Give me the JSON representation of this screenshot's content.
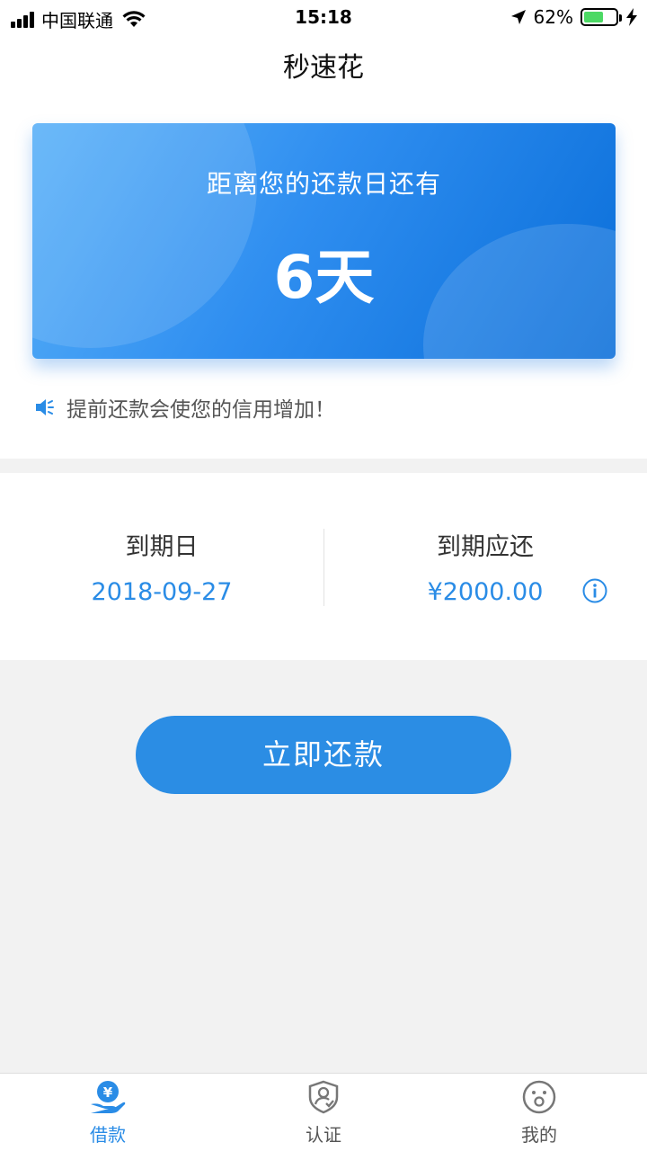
{
  "status_bar": {
    "carrier": "中国联通",
    "time": "15:18",
    "battery": "62%",
    "battery_level": 0.62
  },
  "nav": {
    "title": "秒速花"
  },
  "countdown": {
    "label": "距离您的还款日还有",
    "value": "6天"
  },
  "notice": {
    "text": "提前还款会使您的信用增加！"
  },
  "repayment": {
    "due_date_label": "到期日",
    "due_date": "2018-09-27",
    "amount_label": "到期应还",
    "amount": "¥2000.00"
  },
  "actions": {
    "repay_label": "立即还款"
  },
  "tabs": [
    {
      "label": "借款",
      "icon": "loan-hand-yen-icon",
      "active": true
    },
    {
      "label": "认证",
      "icon": "shield-user-icon",
      "active": false
    },
    {
      "label": "我的",
      "icon": "face-icon",
      "active": false
    }
  ],
  "colors": {
    "accent": "#2b8de4",
    "tab_active": "#2a8ce6",
    "tab_inactive": "#555555"
  }
}
